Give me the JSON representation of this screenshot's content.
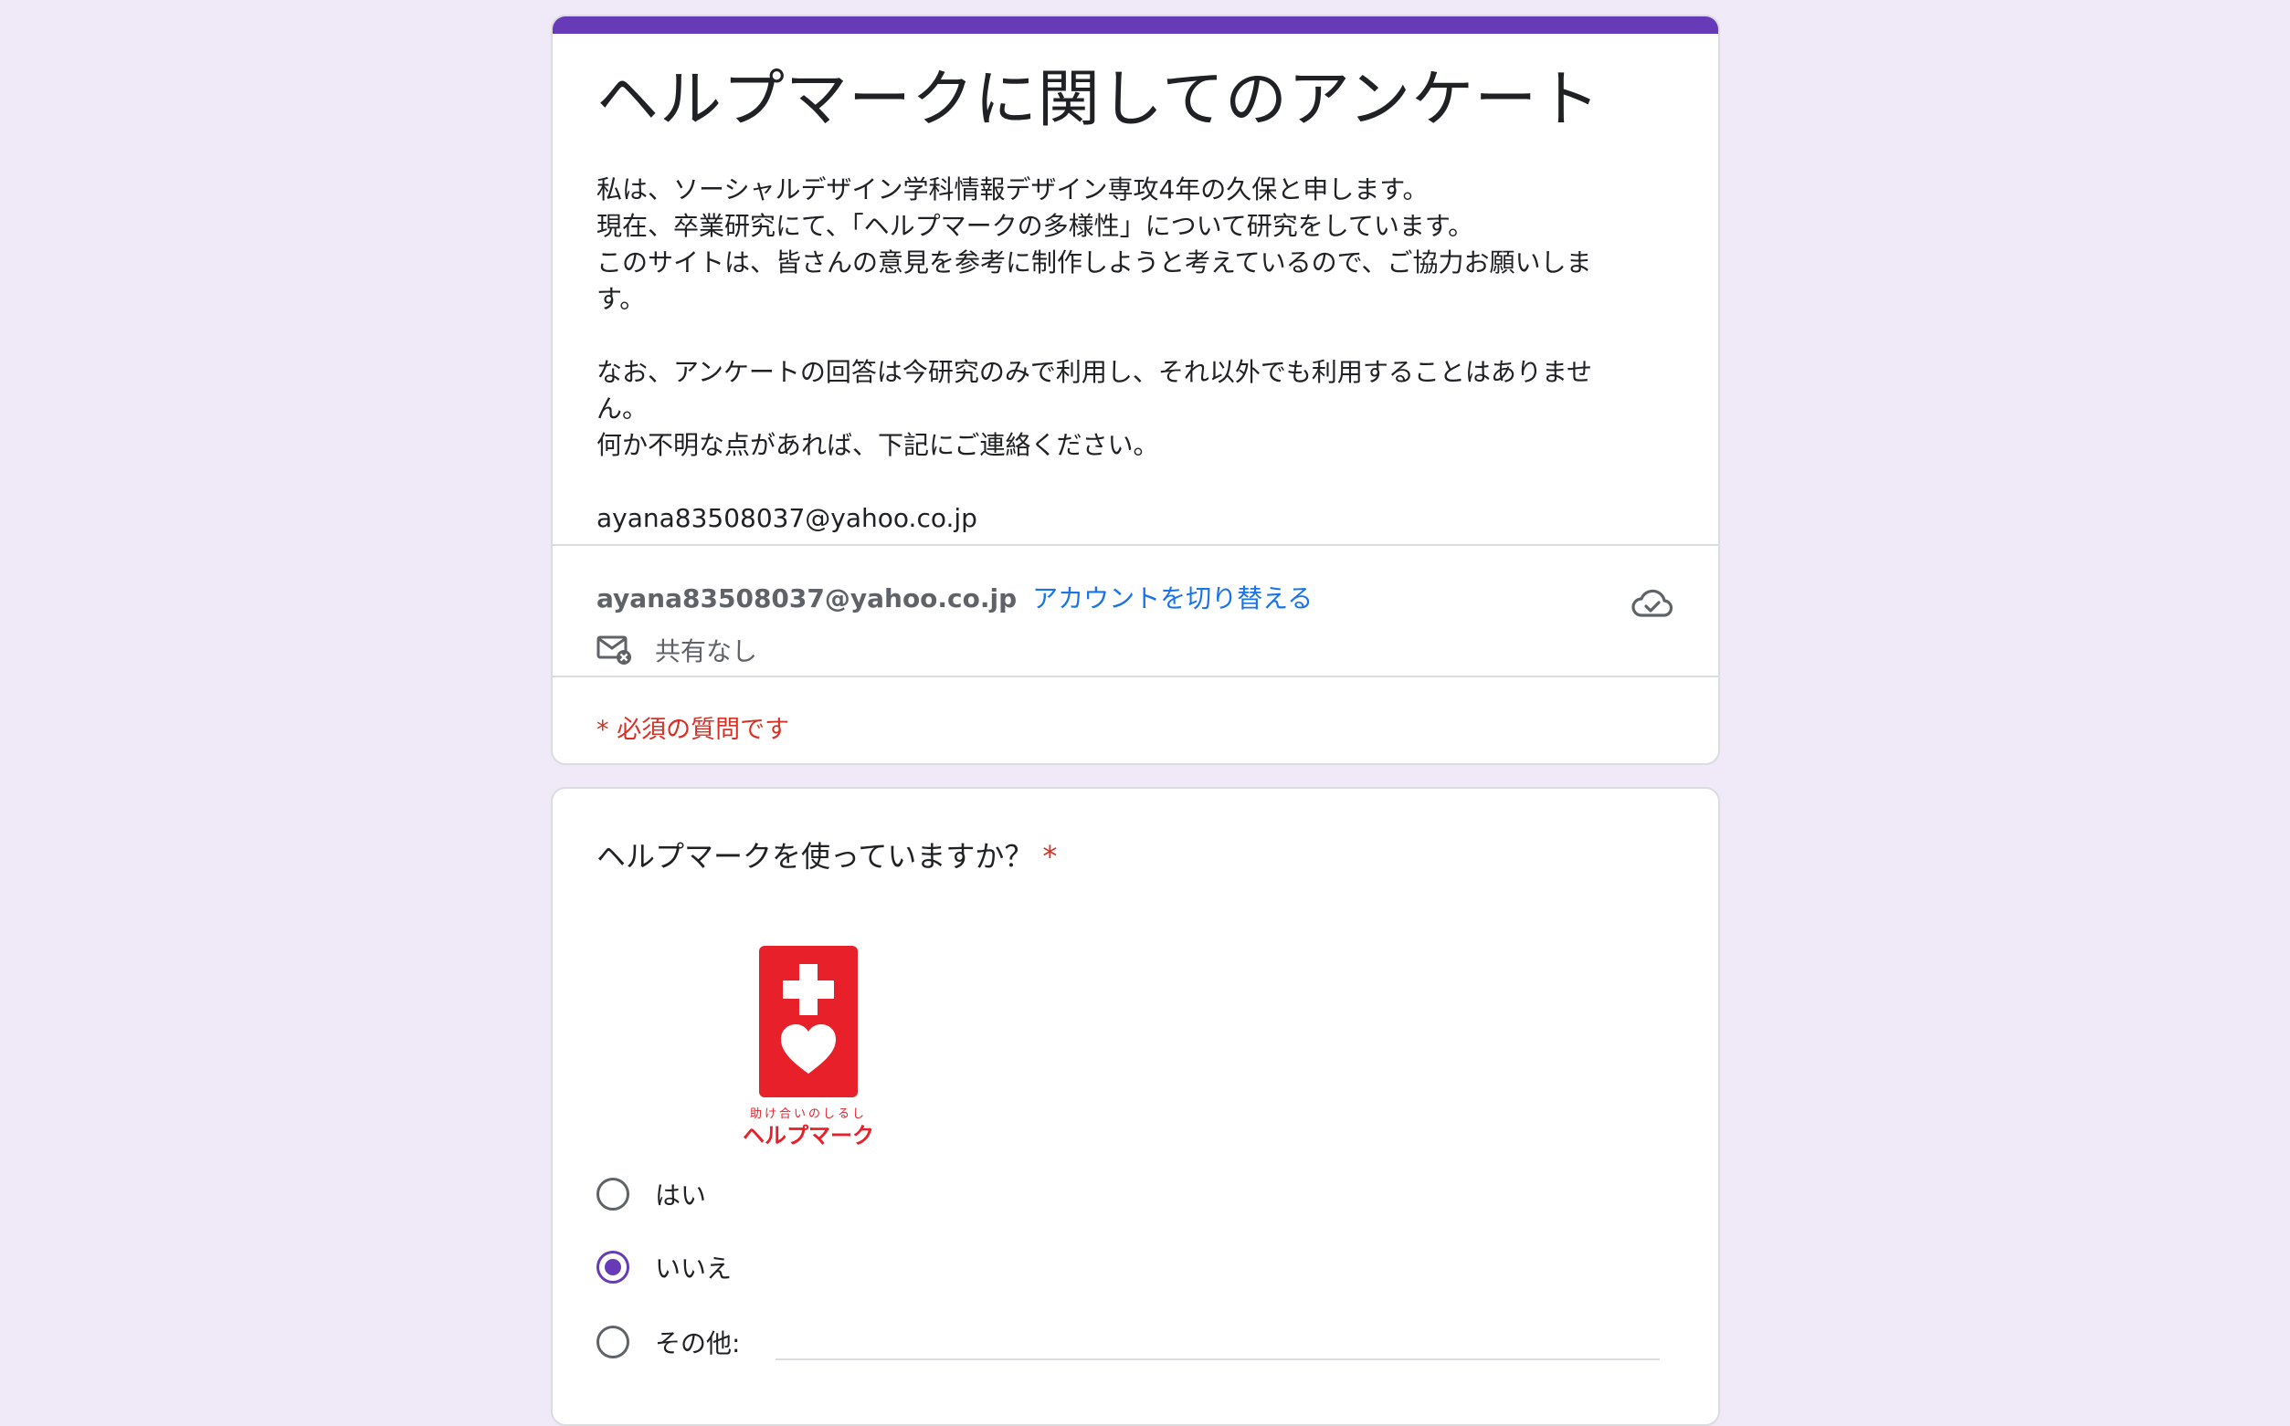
{
  "form": {
    "title": "ヘルプマークに関してのアンケート",
    "description": [
      "私は、ソーシャルデザイン学科情報デザイン専攻4年の久保と申します。",
      "現在、卒業研究にて、「ヘルプマークの多様性」について研究をしています。",
      "このサイトは、皆さんの意見を参考に制作しようと考えているので、ご協力お願いしま",
      "す。",
      "",
      "なお、アンケートの回答は今研究のみで利用し、それ以外でも利用することはありませ",
      "ん。",
      "何か不明な点があれば、下記にご連絡ください。",
      "",
      "ayana83508037@yahoo.co.jp"
    ],
    "account_email": "ayana83508037@yahoo.co.jp",
    "switch_account_label": "アカウントを切り替える",
    "share_status": "共有なし",
    "required_note": "* 必須の質問です",
    "accent_color": "#673ab7",
    "required_color": "#d93025",
    "link_color": "#1a73e8"
  },
  "question": {
    "title": "ヘルプマークを使っていますか？",
    "required_mark": "*",
    "image": {
      "subtitle": "助け合いのしるし",
      "caption": "ヘルプマーク",
      "primary_color": "#e8202a"
    },
    "options": [
      {
        "label": "はい",
        "selected": false
      },
      {
        "label": "いいえ",
        "selected": true
      },
      {
        "label": "その他:",
        "selected": false
      }
    ],
    "other_value": ""
  },
  "icons": {
    "cloud": "cloud-check-icon",
    "share": "mail-not-shared-icon"
  }
}
